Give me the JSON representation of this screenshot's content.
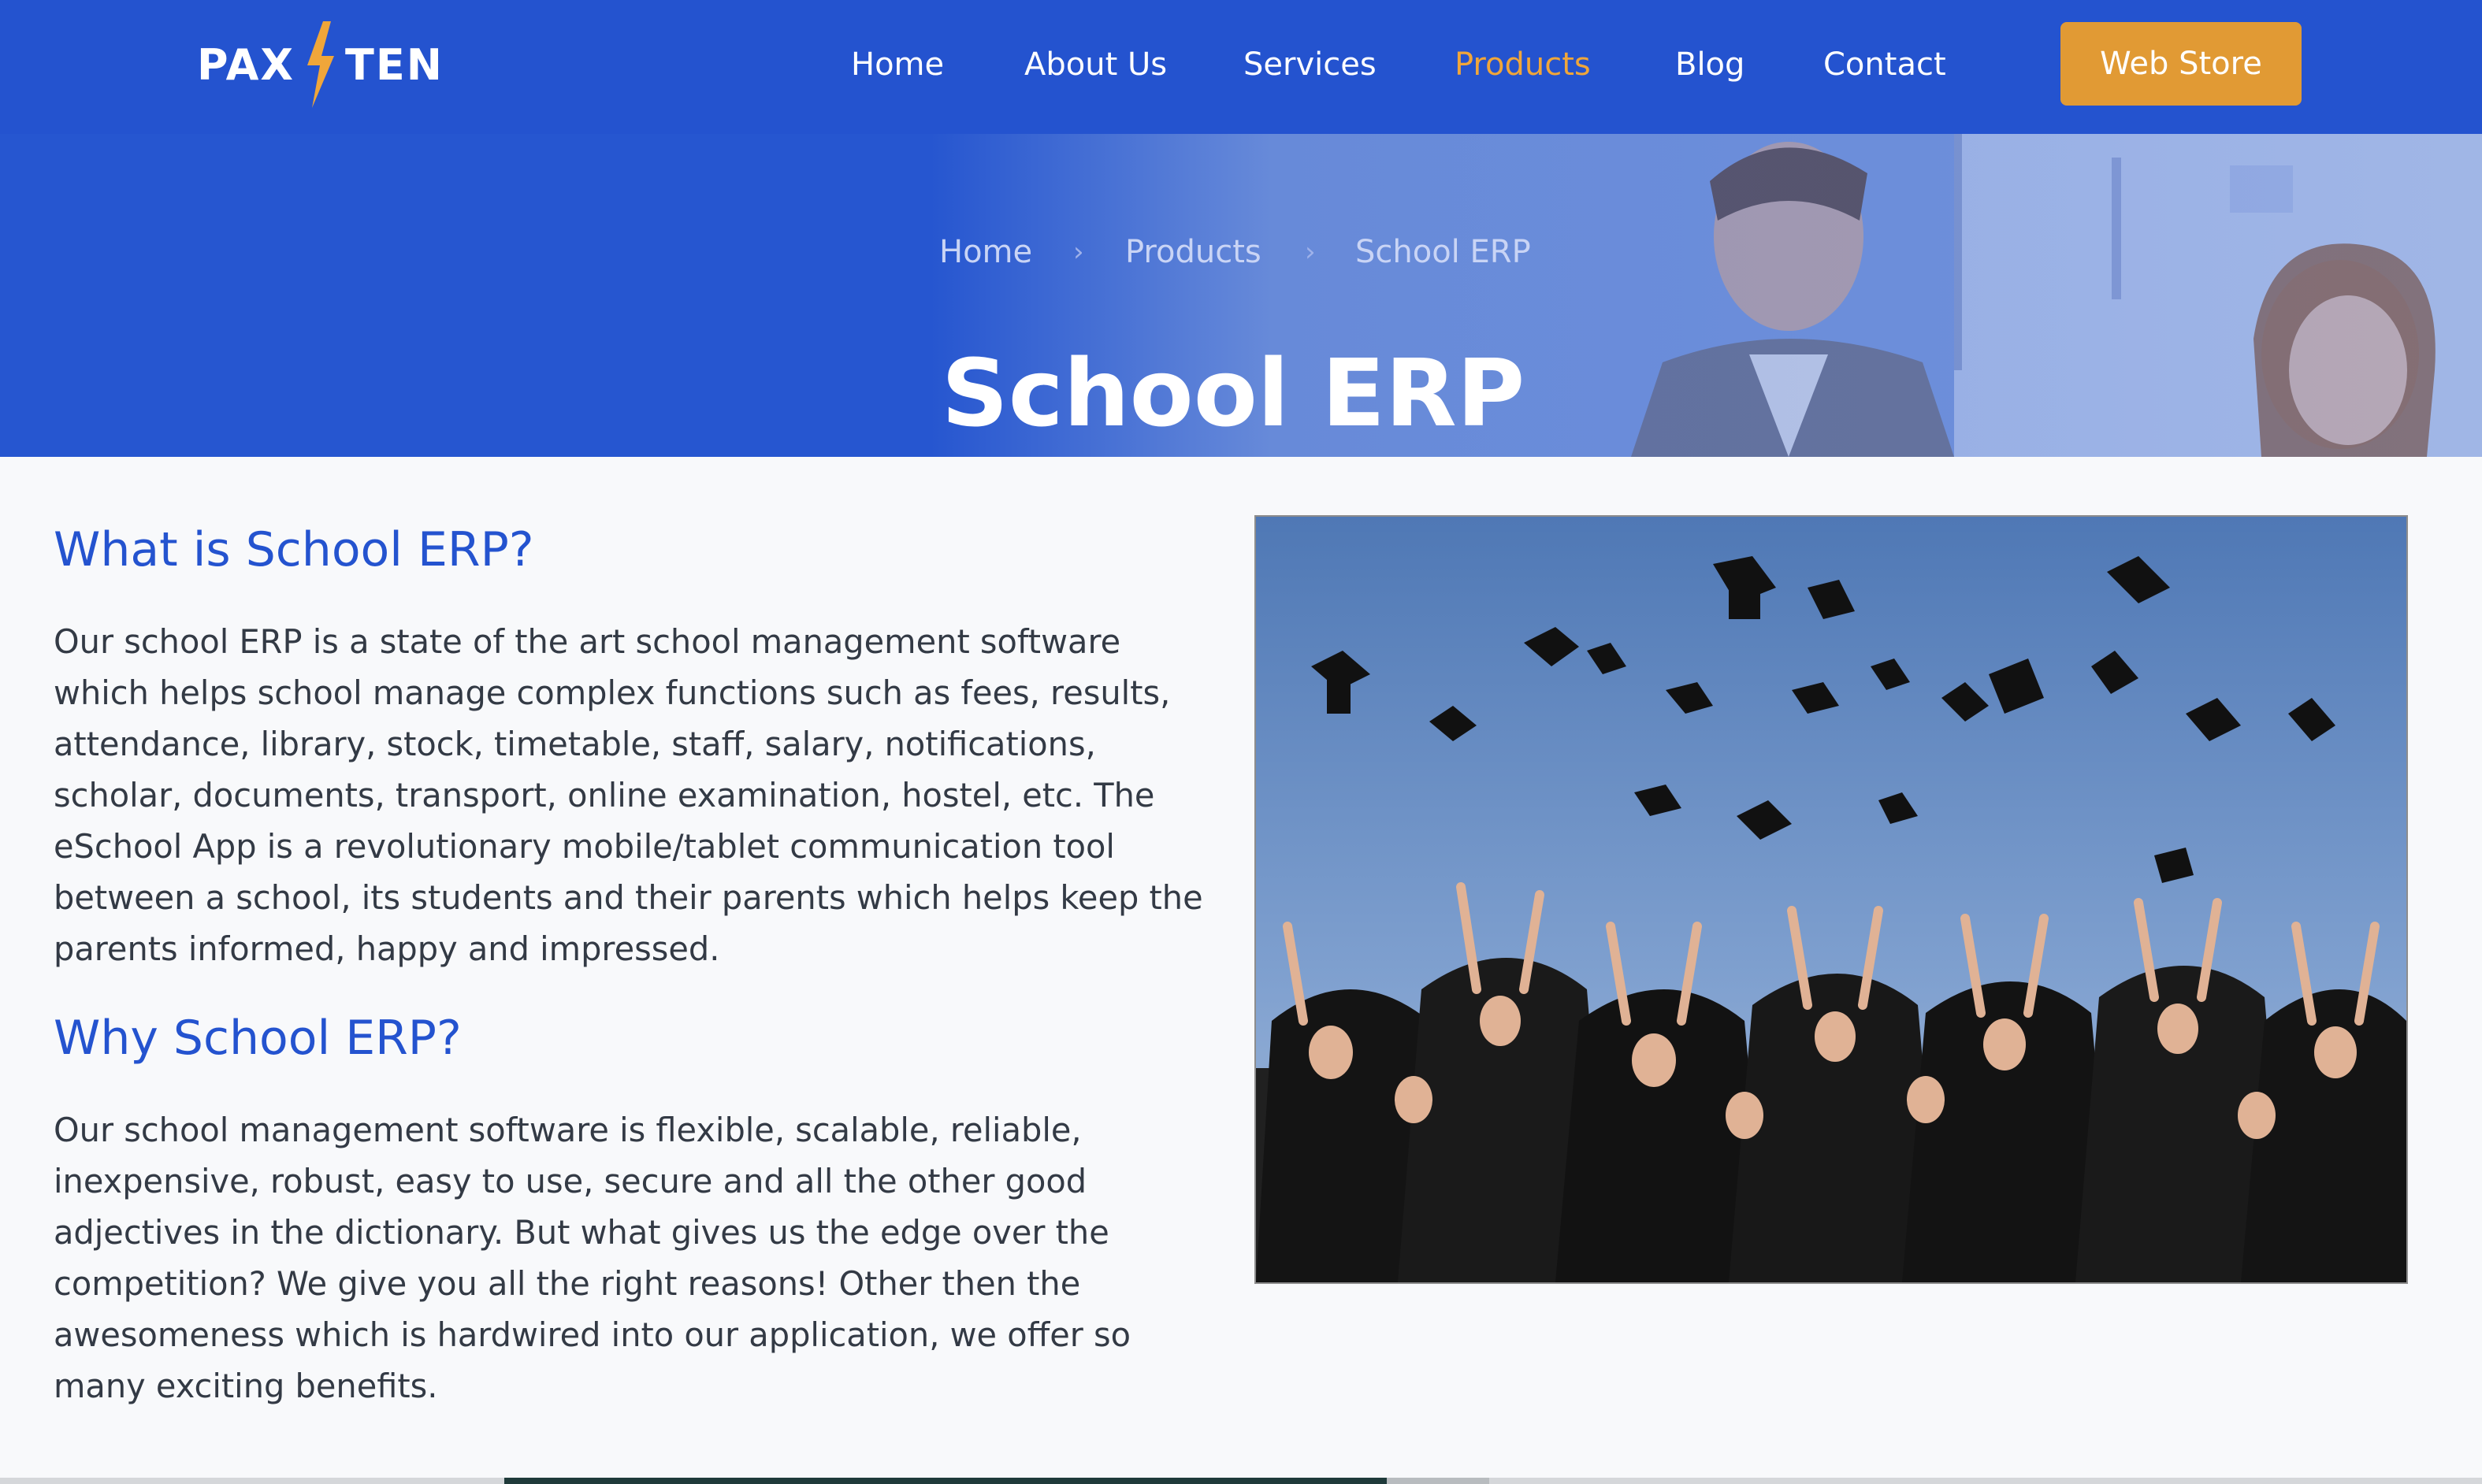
{
  "brand": {
    "logo_left": "PAX",
    "logo_right": "TEN",
    "accent": "#f0a63a",
    "primary": "#2453cf"
  },
  "nav": {
    "items": [
      {
        "label": "Home"
      },
      {
        "label": "About Us"
      },
      {
        "label": "Services"
      },
      {
        "label": "Products",
        "active": true
      },
      {
        "label": "Blog"
      },
      {
        "label": "Contact"
      }
    ],
    "cta_label": "Web Store"
  },
  "hero": {
    "title": "School ERP",
    "breadcrumb": [
      "Home",
      "Products",
      "School ERP"
    ],
    "background_image": "people-smiling-photo"
  },
  "content": {
    "section1": {
      "heading": "What is School ERP?",
      "body": "Our school ERP is a state of the art school management software which helps school manage complex functions such as fees, results, attendance, library, stock, timetable, staff, salary, notifications, scholar, documents, transport, online examination, hostel, etc. The eSchool App is a revolutionary mobile/tablet communication tool between a school, its students and their parents which helps keep the parents informed, happy and impressed."
    },
    "section2": {
      "heading": "Why School ERP?",
      "body": "Our school management software is flexible, scalable, reliable, inexpensive, robust, easy to use, secure and all the other good adjectives in the dictionary. But what gives us the edge over the competition? We give you all the right reasons! Other then the awesomeness which is hardwired into our application, we offer so many exciting benefits."
    },
    "image": "graduation-caps-photo"
  }
}
